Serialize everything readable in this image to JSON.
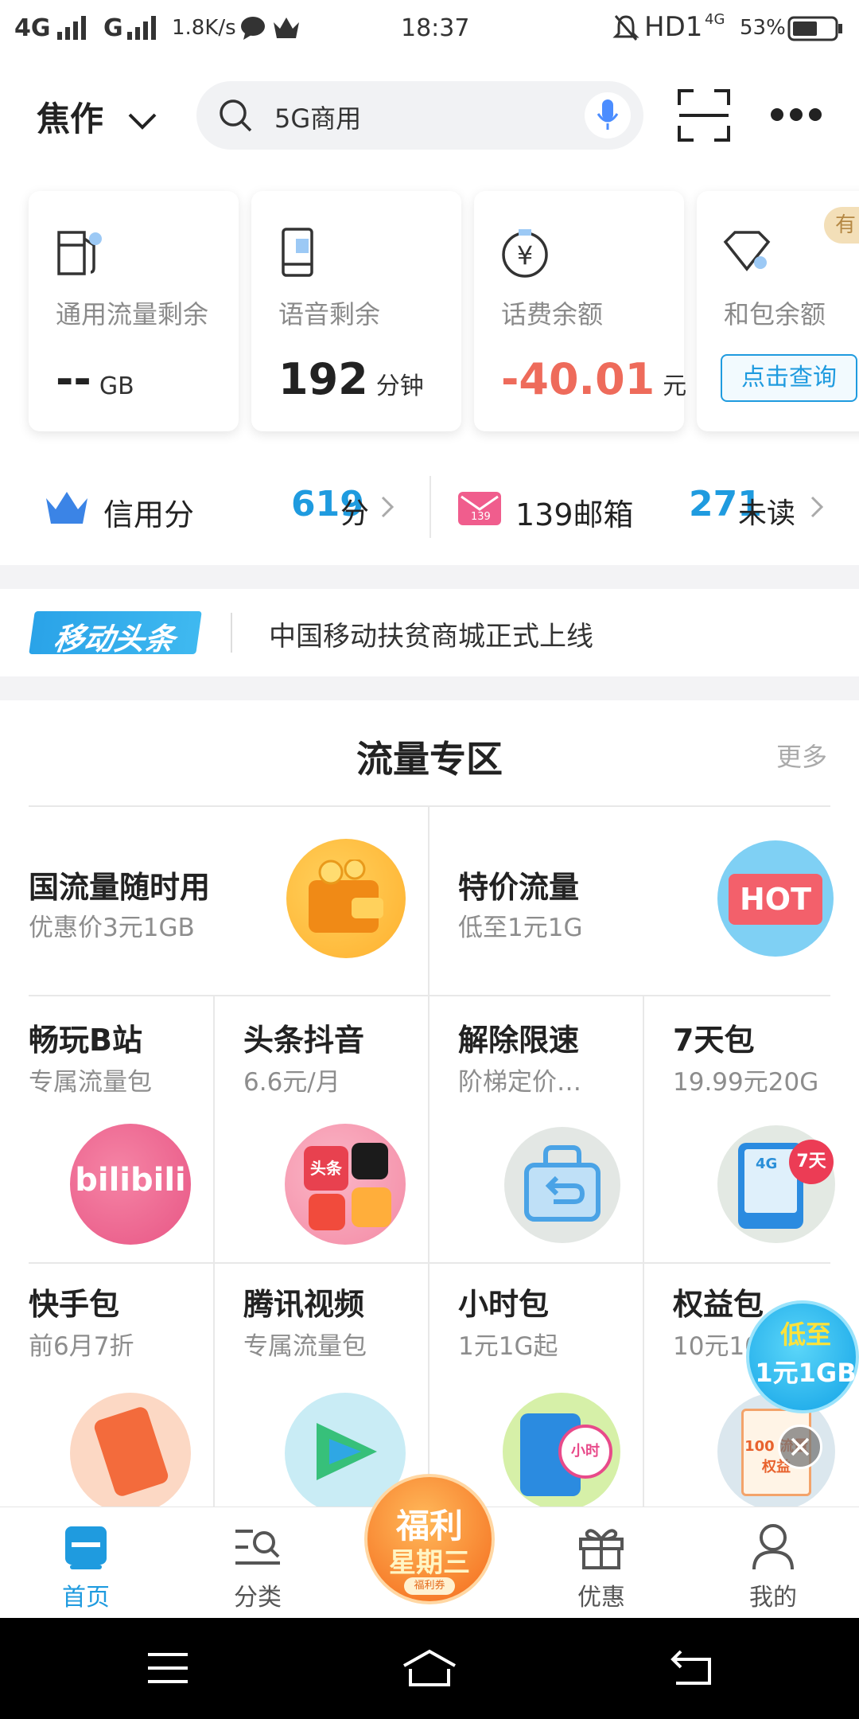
{
  "status_bar": {
    "network": "4G",
    "network2": "G",
    "speed": "1.8K/s",
    "time": "18:37",
    "hd": "HD1",
    "hd_sup": "4G",
    "battery": "53%"
  },
  "header": {
    "city": "焦作",
    "search_text": "5G商用"
  },
  "cards": [
    {
      "label": "通用流量剩余",
      "value": "--",
      "unit": "GB",
      "icon": "fuel-pump-icon"
    },
    {
      "label": "语音剩余",
      "value": "192",
      "unit": "分钟",
      "icon": "phone-icon"
    },
    {
      "label": "话费余额",
      "value": "-40.01",
      "unit": "元",
      "icon": "yen-coin-icon"
    },
    {
      "label": "和包余额",
      "button": "点击查询",
      "badge": "有",
      "icon": "diamond-icon"
    }
  ],
  "credit": {
    "label": "信用分",
    "value": "619",
    "unit": "分"
  },
  "mail": {
    "label": "139邮箱",
    "icon_text": "139",
    "value": "271",
    "unit": "未读"
  },
  "news": {
    "brand": "移动头条",
    "headline": "中国移动扶贫商城正式上线"
  },
  "section": {
    "title": "流量专区",
    "more": "更多",
    "big": [
      {
        "title": "国流量随时用",
        "sub": "优惠价3元1GB"
      },
      {
        "title": "特价流量",
        "sub": "低至1元1G",
        "badge": "HOT"
      }
    ],
    "row1": [
      {
        "title": "畅玩B站",
        "sub": "专属流量包",
        "art": "bilibili"
      },
      {
        "title": "头条抖音",
        "sub": "6.6元/月",
        "art": "头条"
      },
      {
        "title": "解除限速",
        "sub": "阶梯定价…"
      },
      {
        "title": "7天包",
        "sub": "19.99元20G",
        "art": "7天",
        "art2": "4G"
      }
    ],
    "row2": [
      {
        "title": "快手包",
        "sub": "前6月7折"
      },
      {
        "title": "腾讯视频",
        "sub": "专属流量包"
      },
      {
        "title": "小时包",
        "sub": "1元1G起",
        "art": "小时"
      },
      {
        "title": "权益包",
        "sub": "10元10",
        "art": "100 流量权益"
      }
    ]
  },
  "float_ad": {
    "line1": "低至",
    "line2": "1元1GB"
  },
  "tabs": [
    {
      "label": "首页",
      "icon": "home-icon",
      "active": true
    },
    {
      "label": "分类",
      "icon": "category-icon"
    },
    {
      "label": "福利星期三",
      "icon": "promo-icon",
      "line1": "福利",
      "line2": "星期三",
      "tag": "福利券"
    },
    {
      "label": "优惠",
      "icon": "gift-icon"
    },
    {
      "label": "我的",
      "icon": "user-icon"
    }
  ],
  "colors": {
    "accent": "#1f9bdf",
    "negative": "#ee6b5b",
    "tab_active": "#1f9bdf"
  }
}
